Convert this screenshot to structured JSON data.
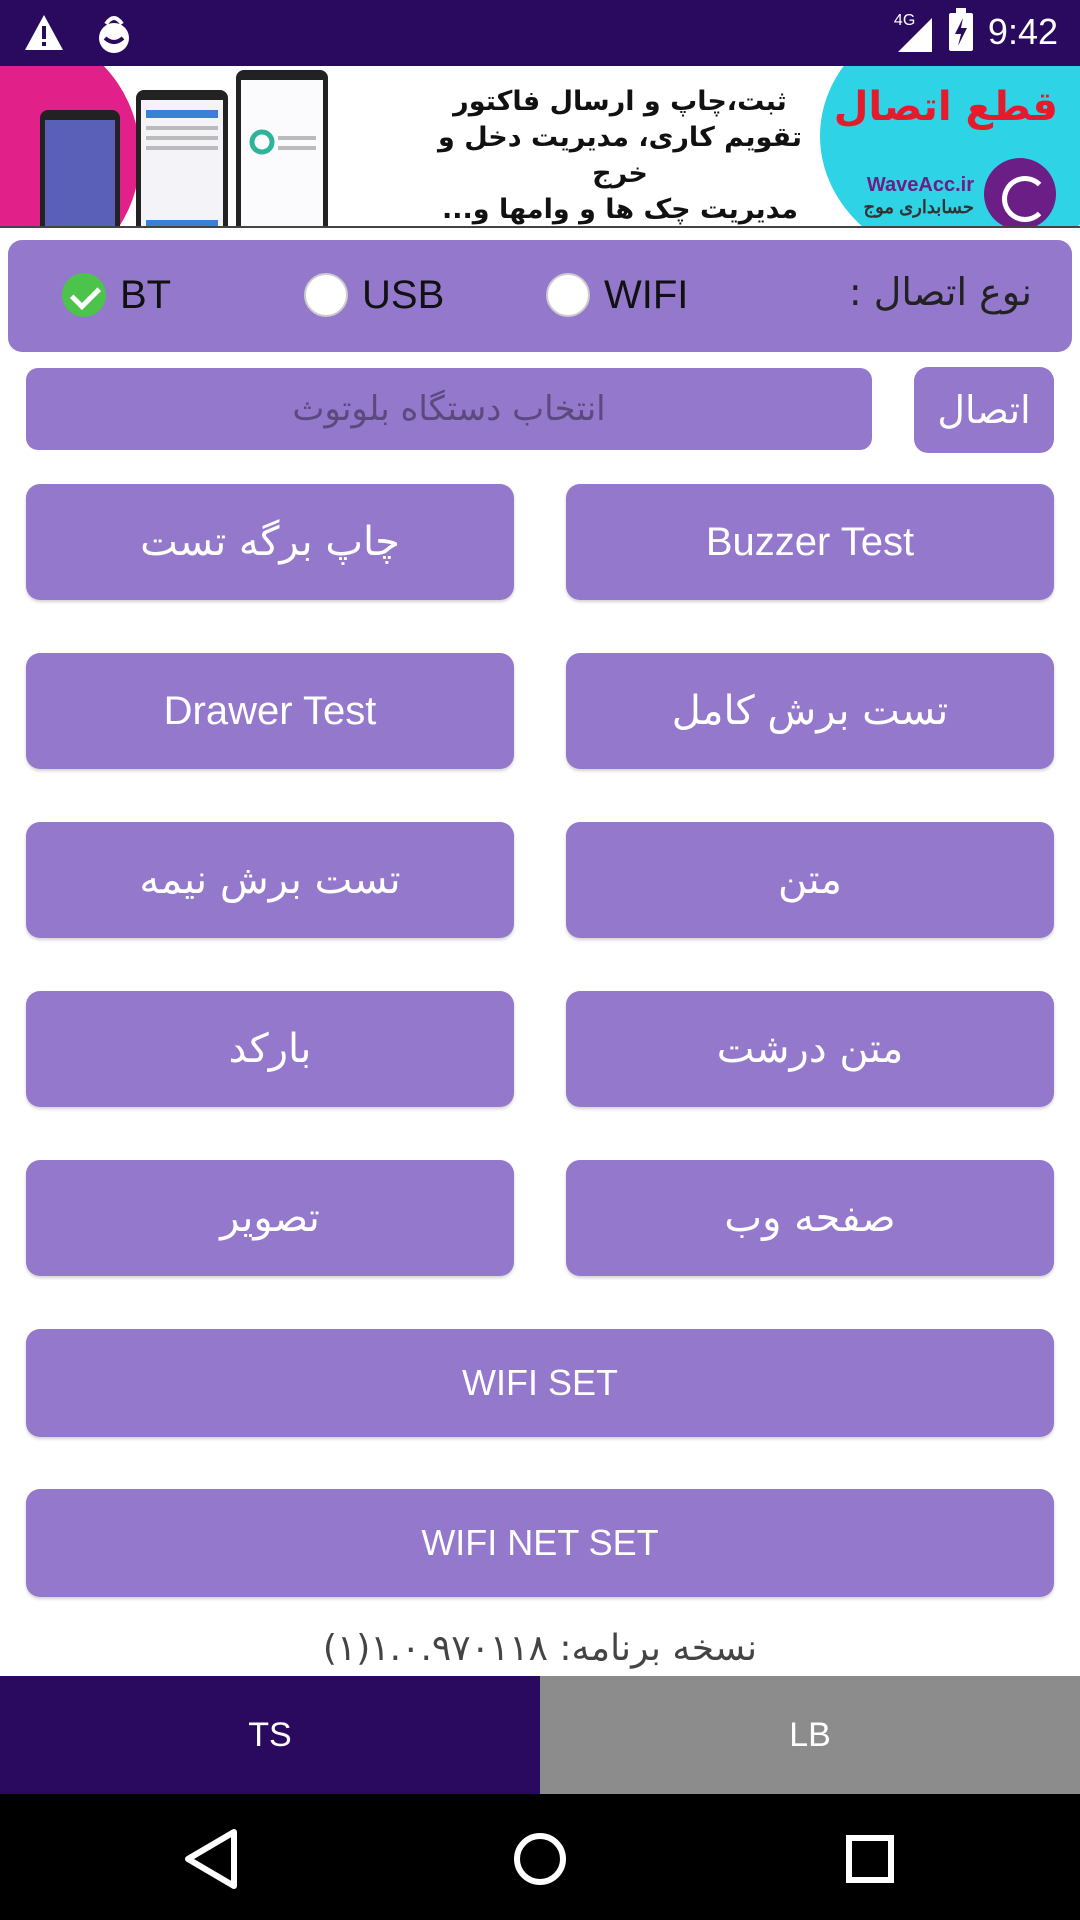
{
  "status_bar": {
    "time": "9:42",
    "network": "4G",
    "left_icons": [
      "warning-icon",
      "shopping-app-icon"
    ],
    "right_icons": [
      "signal-icon",
      "battery-icon"
    ]
  },
  "ad": {
    "title": "قطع اتصال",
    "lines": [
      "ثبت،چاپ و ارسال فاکتور",
      "تقویم کاری، مدیریت دخل و خرج",
      "مدیریت چک ها و وامها و..."
    ],
    "brand_url": "WaveAcc.ir",
    "brand_name": "حسابداری موج"
  },
  "connection": {
    "label": "نوع اتصال :",
    "options": [
      {
        "label": "WIFI",
        "checked": false
      },
      {
        "label": "USB",
        "checked": false
      },
      {
        "label": "BT",
        "checked": true
      }
    ]
  },
  "device": {
    "placeholder": "انتخاب دستگاه بلوتوث",
    "connect_label": "اتصال"
  },
  "buttons": {
    "print_test_page": "چاپ برگه تست",
    "buzzer_test": "Buzzer Test",
    "drawer_test": "Drawer Test",
    "full_cut_test": "تست برش کامل",
    "half_cut_test": "تست برش نیمه",
    "text": "متن",
    "barcode": "بارکد",
    "large_text": "متن درشت",
    "image": "تصویر",
    "web_page": "صفحه وب",
    "wifi_set": "WIFI SET",
    "wifi_net_set": "WIFI NET SET"
  },
  "version": "نسخه برنامه: ۱.۰.۹۷۰۱۱۸(۱)",
  "tabs": [
    {
      "label": "TS",
      "active": true
    },
    {
      "label": "LB",
      "active": false
    }
  ],
  "colors": {
    "primary_dark": "#2a0a5e",
    "button": "#9478cc",
    "tab_inactive": "#8c8c8c",
    "check_green": "#4cc44c"
  }
}
